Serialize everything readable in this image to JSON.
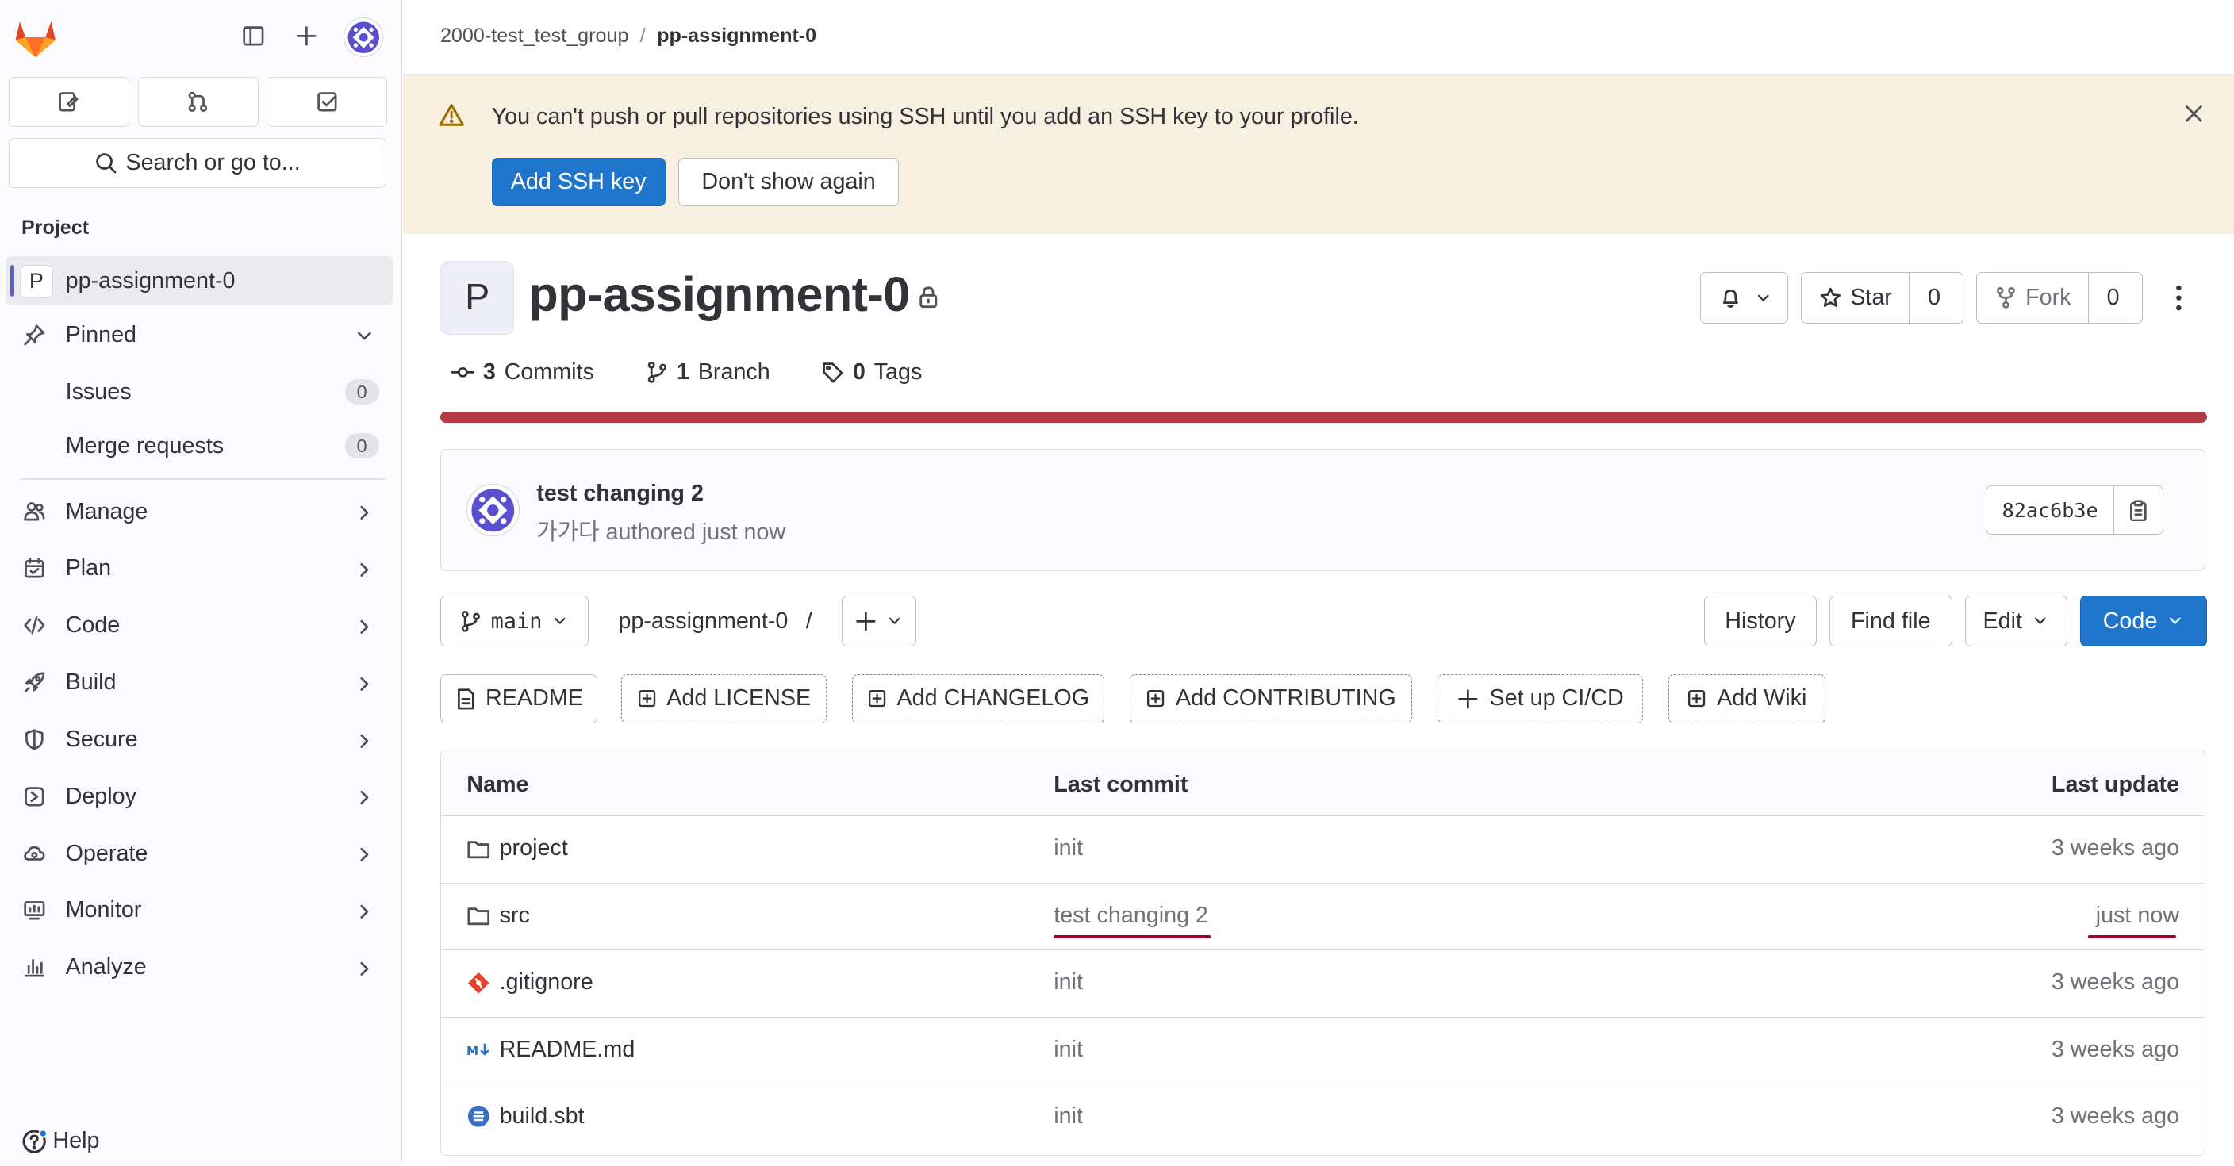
{
  "sidebar": {
    "section_title": "Project",
    "search_placeholder": "Search or go to...",
    "project": {
      "letter": "P",
      "name": "pp-assignment-0"
    },
    "pinned": {
      "label": "Pinned",
      "items": [
        {
          "label": "Issues",
          "count": "0"
        },
        {
          "label": "Merge requests",
          "count": "0"
        }
      ]
    },
    "nav": [
      "Manage",
      "Plan",
      "Code",
      "Build",
      "Secure",
      "Deploy",
      "Operate",
      "Monitor",
      "Analyze"
    ],
    "help": "Help"
  },
  "breadcrumb": {
    "group": "2000-test_test_group",
    "project": "pp-assignment-0"
  },
  "alert": {
    "message": "You can't push or pull repositories using SSH until you add an SSH key to your profile.",
    "primary_button": "Add SSH key",
    "secondary_button": "Don't show again"
  },
  "project": {
    "avatar_letter": "P",
    "title": "pp-assignment-0",
    "star_label": "Star",
    "star_count": "0",
    "fork_label": "Fork",
    "fork_count": "0"
  },
  "stats": {
    "commits_count": "3",
    "commits_label": "Commits",
    "branches_count": "1",
    "branches_label": "Branch",
    "tags_count": "0",
    "tags_label": "Tags"
  },
  "language_bar_color": "#b43b48",
  "last_commit": {
    "title": "test changing 2",
    "author": "가가다",
    "meta_suffix": " authored just now",
    "sha": "82ac6b3e"
  },
  "repo_toolbar": {
    "branch": "main",
    "path": "pp-assignment-0",
    "path_sep": "/",
    "history": "History",
    "find_file": "Find file",
    "edit": "Edit",
    "code": "Code"
  },
  "shortcuts": [
    "README",
    "Add LICENSE",
    "Add CHANGELOG",
    "Add CONTRIBUTING",
    "Set up CI/CD",
    "Add Wiki"
  ],
  "files": {
    "headers": {
      "name": "Name",
      "last_commit": "Last commit",
      "last_update": "Last update"
    },
    "rows": [
      {
        "name": "project",
        "icon": "folder-icon",
        "commit": "init",
        "updated": "3 weeks ago"
      },
      {
        "name": "src",
        "icon": "folder-icon",
        "commit": "test changing 2",
        "updated": "just now"
      },
      {
        "name": ".gitignore",
        "icon": "git-icon",
        "commit": "init",
        "updated": "3 weeks ago"
      },
      {
        "name": "README.md",
        "icon": "markdown-icon",
        "commit": "init",
        "updated": "3 weeks ago"
      },
      {
        "name": "build.sbt",
        "icon": "sbt-icon",
        "commit": "init",
        "updated": "3 weeks ago"
      }
    ]
  },
  "colors": {
    "primary": "#1f75cb",
    "alert_bg": "#f7efdf",
    "annotation_red": "#a3002c"
  }
}
